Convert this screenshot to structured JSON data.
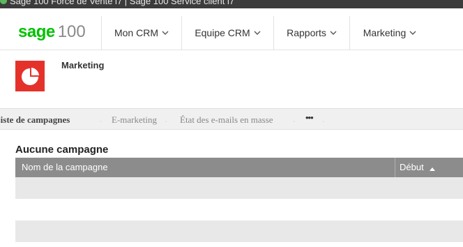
{
  "window": {
    "title": "Sage 100 Force de Vente i7 | Sage 100 Service client i7"
  },
  "logo": {
    "brand": "sage",
    "product": "100"
  },
  "nav": {
    "items": [
      {
        "label": "Mon CRM"
      },
      {
        "label": "Equipe CRM"
      },
      {
        "label": "Rapports"
      },
      {
        "label": "Marketing"
      }
    ]
  },
  "module": {
    "title": "Marketing",
    "icon": "pie-chart-icon"
  },
  "tabs": [
    {
      "label": "Liste de campagnes",
      "active": true
    },
    {
      "label": "E-marketing"
    },
    {
      "label": "État des e-mails en masse"
    },
    {
      "label": "•••"
    }
  ],
  "campaigns": {
    "heading": "Aucune campagne",
    "columns": [
      "Nom de la campagne",
      "Début"
    ],
    "sort": "ascending",
    "rows": []
  },
  "colors": {
    "brand_green": "#00c200",
    "module_red": "#e4322b",
    "header_gray": "#8c8c8c"
  }
}
